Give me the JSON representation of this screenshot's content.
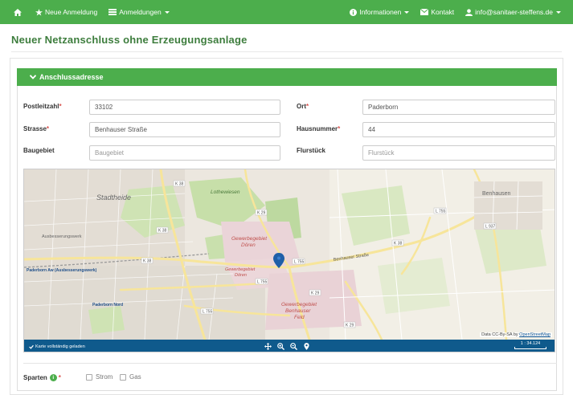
{
  "navbar": {
    "home_icon": "home-icon",
    "new_registration": "Neue Anmeldung",
    "registrations": "Anmeldungen",
    "information": "Informationen",
    "contact": "Kontakt",
    "user": "info@sanitaer-steffens.de",
    "color": "#4cae4c"
  },
  "page": {
    "title": "Neuer Netzanschluss ohne Erzeugungsanlage"
  },
  "section": {
    "header": "Anschlussadresse"
  },
  "form": {
    "plz_label": "Postleitzahl",
    "plz_value": "33102",
    "ort_label": "Ort",
    "ort_value": "Paderborn",
    "strasse_label": "Strasse",
    "strasse_value": "Benhauser Straße",
    "hausnummer_label": "Hausnummer",
    "hausnummer_value": "44",
    "baugebiet_label": "Baugebiet",
    "baugebiet_placeholder": "Baugebiet",
    "flurstueck_label": "Flurstück",
    "flurstueck_placeholder": "Flurstück",
    "required_mark": "*"
  },
  "map": {
    "labels": {
      "stadtheide": "Stadtheide",
      "lothewiesen": "Lothewiesen",
      "benhausen": "Benhausen",
      "ausbesserungswerk": "Ausbesserungswerk",
      "paderborn_aw": "Paderborn Aw (Ausbesserungswerk)",
      "gewerbegebiet1": "Gewerbegebiet",
      "doeren1": "Dören",
      "gewerbegebiet2": "Gewerbegebiet",
      "doeren2": "Dören",
      "gewerbegebiet3": "Gewerbegebiet",
      "benhauser": "Benhauser",
      "feld": "Feld",
      "paderborn_nord": "Paderborn Nord",
      "benhauser_strasse": "Benhauser Straße",
      "k38a": "K 38",
      "k38b": "K 38",
      "k38c": "K 38",
      "k29a": "K 29",
      "k29b": "K 29",
      "k29c": "K 29",
      "l755a": "L 755",
      "l755b": "L 755",
      "l755c": "L 755",
      "l755d": "L 755",
      "l937": "L 937",
      "k38d": "K 38",
      "road_k29_label": "K 29"
    },
    "attribution_prefix": "Data CC-By-SA by",
    "attribution_link": "OpenStreetMap",
    "status": "Karte vollständig geladen",
    "scale": "1 : 34.124",
    "toolbar_color": "#0f5a8c"
  },
  "sparten": {
    "label": "Sparten",
    "required_mark": "*",
    "option_strom": "Strom",
    "option_gas": "Gas"
  }
}
